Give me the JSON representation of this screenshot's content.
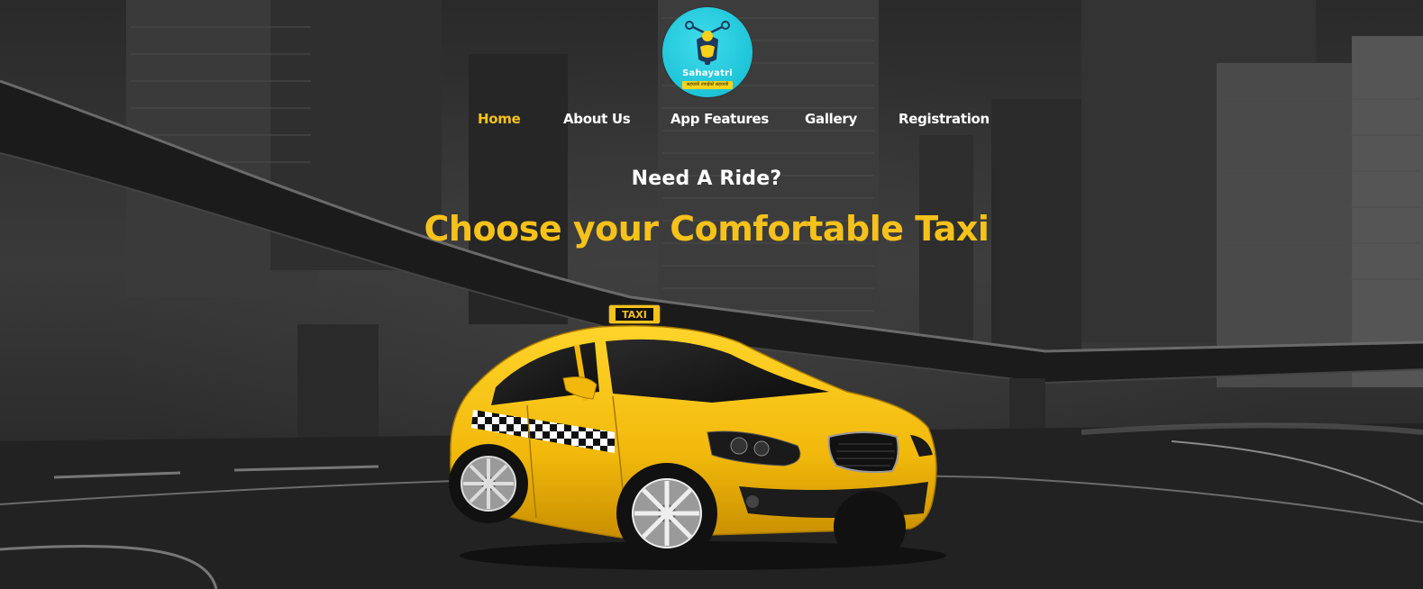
{
  "logo": {
    "name": "Sahayatri",
    "tagline": "सहयात्री तपाईको सहयात्री"
  },
  "nav": {
    "items": [
      {
        "label": "Home",
        "active": true
      },
      {
        "label": "About Us",
        "active": false
      },
      {
        "label": "App Features",
        "active": false
      },
      {
        "label": "Gallery",
        "active": false
      },
      {
        "label": "Registration",
        "active": false
      }
    ]
  },
  "hero": {
    "subtitle": "Need A Ride?",
    "title": "Choose your Comfortable Taxi",
    "roof_sign": "TAXI"
  },
  "colors": {
    "accent": "#f5c21b",
    "logo_bg": "#1fc4d8",
    "text": "#ffffff"
  }
}
